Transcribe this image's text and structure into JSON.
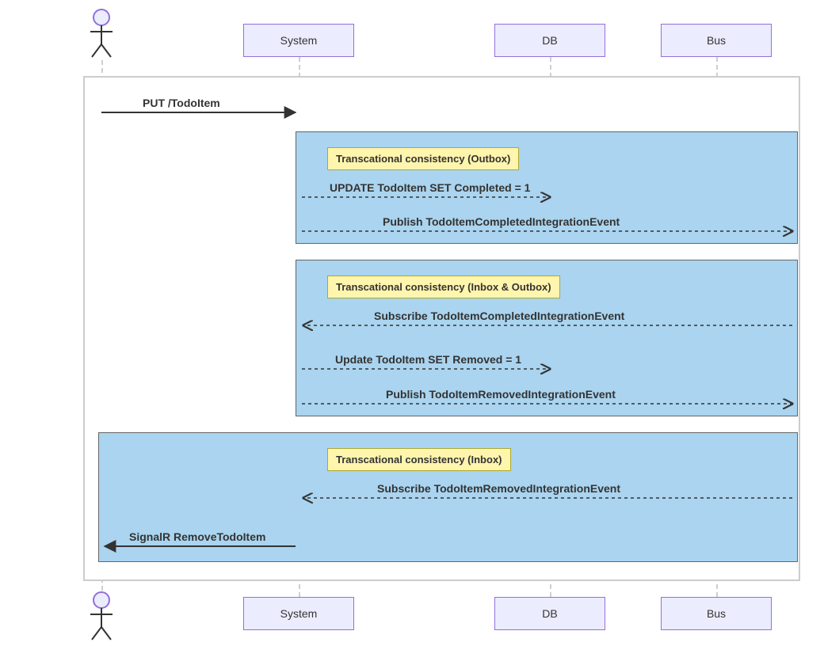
{
  "participants": {
    "actor": "Actor",
    "system": "System",
    "db": "DB",
    "bus": "Bus"
  },
  "notes": {
    "outbox": "Transcational consistency (Outbox)",
    "inbox_outbox": "Transcational consistency (Inbox & Outbox)",
    "inbox": "Transcational consistency (Inbox)"
  },
  "messages": {
    "m1": "PUT /TodoItem",
    "m2": "UPDATE TodoItem SET Completed = 1",
    "m3": "Publish TodoItemCompletedIntegrationEvent",
    "m4": "Subscribe TodoItemCompletedIntegrationEvent",
    "m5": "Update TodoItem SET Removed = 1",
    "m6": "Publish TodoItemRemovedIntegrationEvent",
    "m7": "Subscribe TodoItemRemovedIntegrationEvent",
    "m8": "SignalR RemoveTodoItem"
  },
  "layout": {
    "lanes": {
      "actor": 118,
      "system": 367,
      "db": 684,
      "bus": 894
    }
  }
}
